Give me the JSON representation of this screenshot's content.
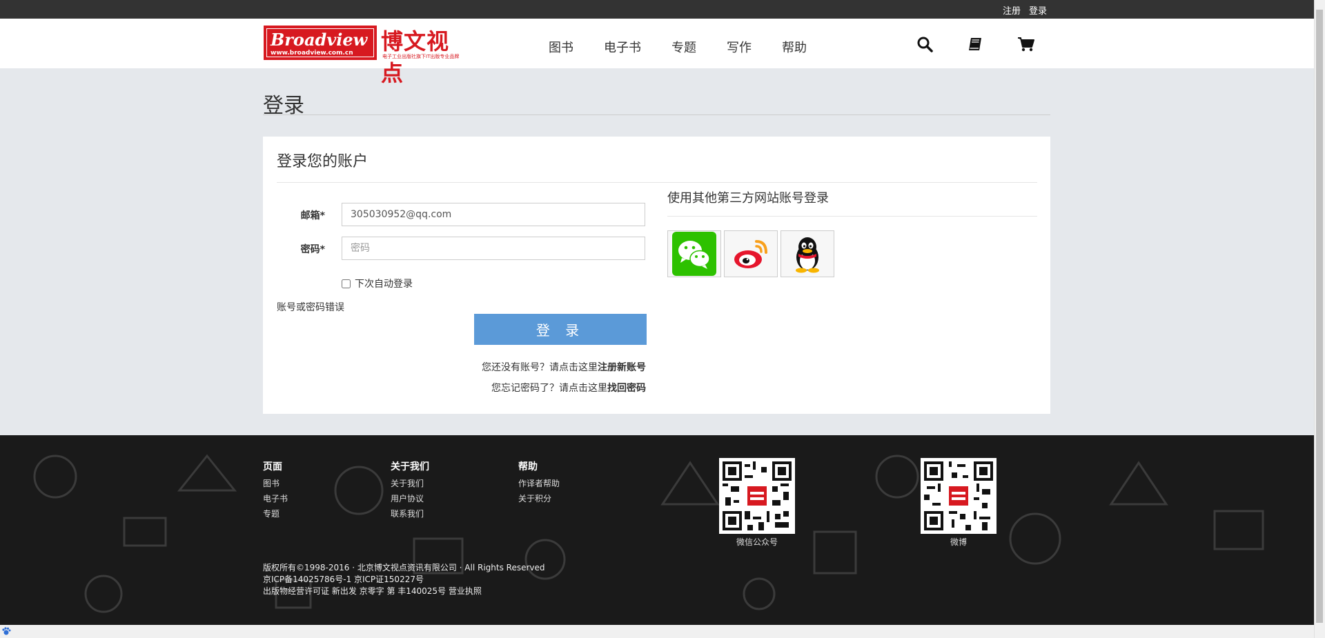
{
  "topbar": {
    "register": "注册",
    "login": "登录"
  },
  "logo": {
    "brand": "Broadview",
    "url": "www.broadview.com.cn",
    "cn": "博文视点",
    "sub": "电子工业出版社旗下IT出版专业品牌"
  },
  "nav": {
    "books": "图书",
    "ebooks": "电子书",
    "topics": "专题",
    "writing": "写作",
    "help": "帮助"
  },
  "icons": [
    "search-icon",
    "book-icon",
    "cart-icon"
  ],
  "page": {
    "title": "登录"
  },
  "login": {
    "heading": "登录您的账户",
    "email_label": "邮箱*",
    "email_value": "305030952@qq.com",
    "password_label": "密码*",
    "password_placeholder": "密码",
    "remember": "下次自动登录",
    "error": "账号或密码错误",
    "button": "登 录",
    "register_prefix": "您还没有账号？请点击这里",
    "register_link": "注册新账号",
    "forgot_prefix": "您忘记密码了？请点击这里",
    "forgot_link": "找回密码"
  },
  "third_party": {
    "heading": "使用其他第三方网站账号登录",
    "providers": [
      "wechat",
      "weibo",
      "qq"
    ]
  },
  "footer": {
    "col1": {
      "title": "页面",
      "links": [
        "图书",
        "电子书",
        "专题"
      ]
    },
    "col2": {
      "title": "关于我们",
      "links": [
        "关于我们",
        "用户协议",
        "联系我们"
      ]
    },
    "col3": {
      "title": "帮助",
      "links": [
        "作译者帮助",
        "关于积分"
      ]
    },
    "qr1": "微信公众号",
    "qr2": "微博",
    "copyright1": "版权所有©1998-2016 · 北京博文视点资讯有限公司 · All Rights Reserved",
    "copyright2": "京ICP备14025786号-1  京ICP证150227号",
    "copyright3": "出版物经营许可证 新出发 京零字 第 丰140025号 营业执照"
  },
  "colors": {
    "brand_red": "#d71920",
    "button_blue": "#5b9ad8",
    "wechat_green": "#2dc100",
    "weibo_red": "#e6162d"
  }
}
